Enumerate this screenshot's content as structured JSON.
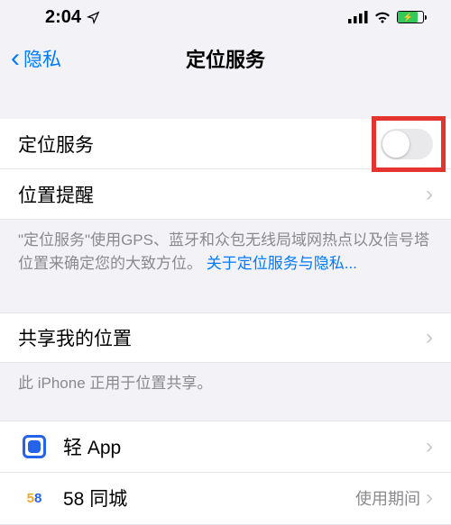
{
  "status": {
    "time": "2:04"
  },
  "nav": {
    "back": "隐私",
    "title": "定位服务"
  },
  "rows": {
    "location_services": "定位服务",
    "location_alerts": "位置提醒",
    "share_my_location": "共享我的位置"
  },
  "footer": {
    "explain": "\"定位服务\"使用GPS、蓝牙和众包无线局域网热点以及信号塔位置来确定您的大致方位。",
    "link": "关于定位服务与隐私...",
    "share_note": "此 iPhone 正用于位置共享。"
  },
  "apps": {
    "qingapp": {
      "name": "轻 App"
    },
    "tongcheng": {
      "name": "58 同城",
      "detail": "使用期间"
    }
  }
}
